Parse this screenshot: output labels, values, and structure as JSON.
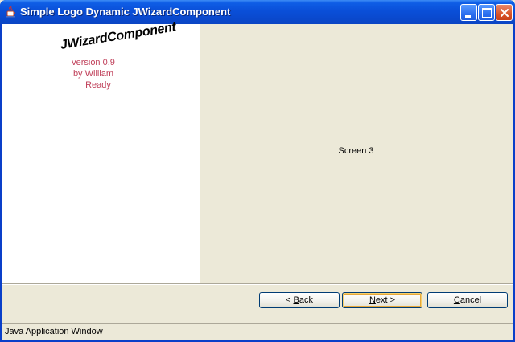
{
  "window": {
    "title": "Simple Logo Dynamic JWizardComponent",
    "icon": "java-cup-icon"
  },
  "logo": {
    "title": "JWizardComponent",
    "version": "version 0.9",
    "author": "by William",
    "status": "Ready",
    "text_color": "#c0405a"
  },
  "content": {
    "screen_label": "Screen 3"
  },
  "buttons": {
    "back": {
      "accel": "B",
      "rest": "ack",
      "prefix": "< "
    },
    "next": {
      "accel": "N",
      "rest": "ext >"
    },
    "cancel": {
      "accel": "C",
      "rest": "ancel"
    }
  },
  "statusbar": {
    "text": "Java Application Window"
  },
  "colors": {
    "titlebar": "#0a4fd8",
    "background": "#ece9d8",
    "close_button": "#d9542a"
  }
}
